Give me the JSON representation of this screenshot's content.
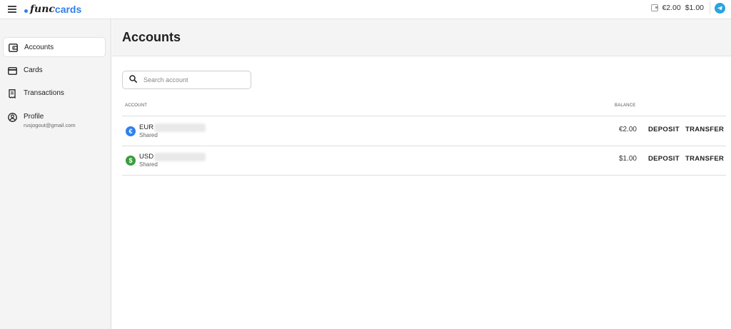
{
  "app": {
    "logo_prefix": "func",
    "logo_suffix": "cards",
    "brand_color": "#2f80ed"
  },
  "topbar": {
    "menu_icon": "hamburger-icon",
    "wallet_icon": "wallet-icon",
    "balance_eur": "€2.00",
    "balance_usd": "$1.00",
    "telegram_icon": "telegram-icon"
  },
  "sidebar": {
    "items": [
      {
        "label": "Accounts",
        "icon": "wallet-icon",
        "active": true
      },
      {
        "label": "Cards",
        "icon": "card-icon",
        "active": false
      },
      {
        "label": "Transactions",
        "icon": "receipt-icon",
        "active": false
      },
      {
        "label": "Profile",
        "icon": "user-icon",
        "active": false,
        "sub": "rusjogout@gmail.com"
      }
    ]
  },
  "main": {
    "title": "Accounts",
    "search_placeholder": "Search account",
    "columns": {
      "account": "ACCOUNT",
      "balance": "BALANCE"
    },
    "rows": [
      {
        "currency": "EUR",
        "symbol": "€",
        "color": "#2f80ed",
        "type": "Shared",
        "balance": "€2.00",
        "deposit": "DEPOSIT",
        "transfer": "TRANSFER"
      },
      {
        "currency": "USD",
        "symbol": "$",
        "color": "#3a9d3e",
        "type": "Shared",
        "balance": "$1.00",
        "deposit": "DEPOSIT",
        "transfer": "TRANSFER"
      }
    ]
  }
}
